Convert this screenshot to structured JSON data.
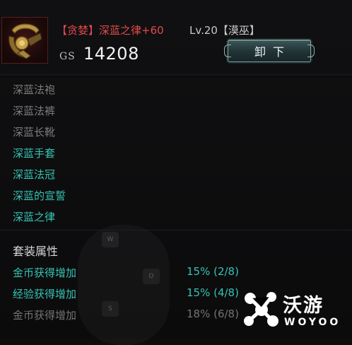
{
  "item": {
    "name": "【贪婪】深蓝之律+60",
    "level": "Lv.20【漠巫】",
    "gs_label": "GS",
    "gs_value": "14208",
    "unequip_label": "卸下",
    "name_color": "#e24a4a"
  },
  "set_pieces": [
    {
      "label": "深蓝法袍",
      "owned": false
    },
    {
      "label": "深蓝法裤",
      "owned": false
    },
    {
      "label": "深蓝长靴",
      "owned": false
    },
    {
      "label": "深蓝手套",
      "owned": true
    },
    {
      "label": "深蓝法冠",
      "owned": true
    },
    {
      "label": "深蓝的宣誓",
      "owned": true
    },
    {
      "label": "深蓝之律",
      "owned": true
    }
  ],
  "set_bonus": {
    "title": "套装属性",
    "rows": [
      {
        "label": "金币获得增加",
        "value": "15% (2/8)",
        "active": true
      },
      {
        "label": "经验获得增加",
        "value": "15% (4/8)",
        "active": true
      },
      {
        "label": "金币获得增加",
        "value": "18% (6/8)",
        "active": false
      }
    ]
  },
  "overlay_keys": [
    "W",
    "D",
    "S"
  ],
  "watermark": {
    "cn": "沃游",
    "en": "WOYOO"
  },
  "colors": {
    "owned": "#35c3b3",
    "unowned": "#7c7c7c",
    "button": "#233537"
  }
}
